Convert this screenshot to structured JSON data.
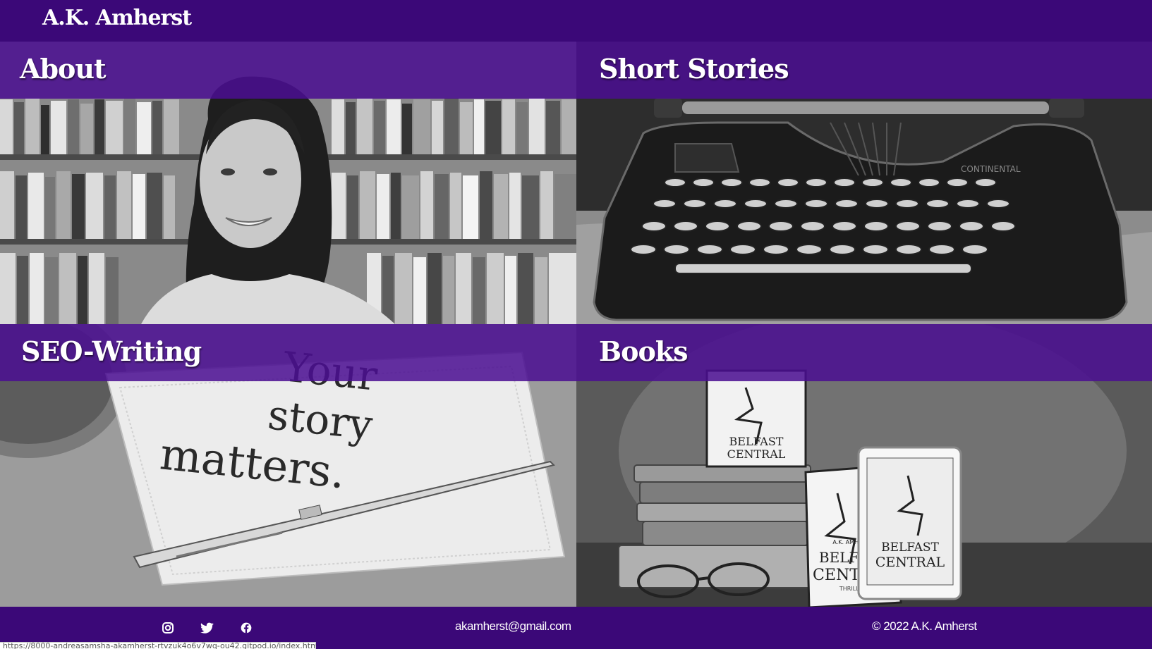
{
  "header": {
    "site_title": "A.K. Amherst"
  },
  "tiles": [
    {
      "title": "About",
      "image": "portrait-bookshelf-photo"
    },
    {
      "title": "Short Stories",
      "image": "typewriter-photo"
    },
    {
      "title": "SEO-Writing",
      "image": "napkin-pen-photo"
    },
    {
      "title": "Books",
      "image": "books-stack-photo"
    }
  ],
  "napkin_text": {
    "line1": "Your",
    "line2": "story",
    "line3": "matters."
  },
  "book": {
    "author": "A.K. AMHERST",
    "title_line1": "BELFAST",
    "title_line2": "CENTRAL",
    "genre": "THRILLER"
  },
  "typewriter_brand": "CONTINENTAL",
  "footer": {
    "social_icons": [
      "instagram-icon",
      "twitter-icon",
      "facebook-icon"
    ],
    "email": "akamherst@gmail.com",
    "copyright": "© 2022 A.K. Amherst"
  },
  "status_bar": {
    "url": "https://8000-andreasamsha-akamherst-rtvzuk4o6v7wq-ou42.gitpod.io/index.html"
  },
  "colors": {
    "brand_purple": "#3b0878",
    "banner_purple": "#4b0e91",
    "text": "#ffffff"
  }
}
